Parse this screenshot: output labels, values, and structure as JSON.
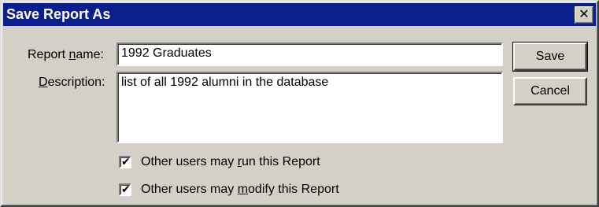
{
  "window": {
    "title": "Save Report As",
    "close_glyph": "✕"
  },
  "form": {
    "report_name_label_pre": "Report ",
    "report_name_label_accel": "n",
    "report_name_label_post": "ame:",
    "report_name_value": "1992 Graduates",
    "description_label_accel": "D",
    "description_label_post": "escription:",
    "description_value": "list of all 1992 alumni in the database"
  },
  "buttons": {
    "save_label": "Save",
    "cancel_label": "Cancel"
  },
  "options": {
    "run": {
      "checked": true,
      "label_pre": "Other users may ",
      "label_accel": "r",
      "label_post": "un this Report"
    },
    "modify": {
      "checked": true,
      "label_pre": "Other users may ",
      "label_accel": "m",
      "label_post": "odify this Report"
    }
  },
  "colors": {
    "titlebar": "#0a1e8c",
    "dialog_face": "#d4d0c8"
  }
}
